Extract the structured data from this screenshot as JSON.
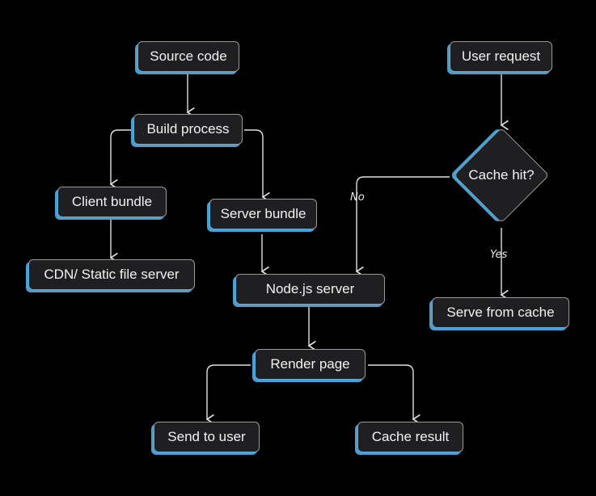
{
  "diagram": {
    "title": "",
    "nodes": [
      {
        "id": "source_code",
        "label": "Source code"
      },
      {
        "id": "build_process",
        "label": "Build process"
      },
      {
        "id": "client_bundle",
        "label": "Client bundle"
      },
      {
        "id": "server_bundle",
        "label": "Server bundle"
      },
      {
        "id": "cdn",
        "label": "CDN/ Static file server"
      },
      {
        "id": "node_server",
        "label": "Node.js server"
      },
      {
        "id": "render_page",
        "label": "Render page"
      },
      {
        "id": "send_to_user",
        "label": "Send to user"
      },
      {
        "id": "cache_result",
        "label": "Cache result"
      },
      {
        "id": "user_request",
        "label": "User request"
      },
      {
        "id": "cache_hit",
        "label": "Cache hit?"
      },
      {
        "id": "serve_from_cache",
        "label": "Serve from cache"
      }
    ],
    "edges": [
      {
        "from": "source_code",
        "to": "build_process",
        "label": ""
      },
      {
        "from": "build_process",
        "to": "client_bundle",
        "label": ""
      },
      {
        "from": "build_process",
        "to": "server_bundle",
        "label": ""
      },
      {
        "from": "client_bundle",
        "to": "cdn",
        "label": ""
      },
      {
        "from": "server_bundle",
        "to": "node_server",
        "label": ""
      },
      {
        "from": "node_server",
        "to": "render_page",
        "label": ""
      },
      {
        "from": "render_page",
        "to": "send_to_user",
        "label": ""
      },
      {
        "from": "render_page",
        "to": "cache_result",
        "label": ""
      },
      {
        "from": "user_request",
        "to": "cache_hit",
        "label": ""
      },
      {
        "from": "cache_hit",
        "to": "node_server",
        "label": "No"
      },
      {
        "from": "cache_hit",
        "to": "serve_from_cache",
        "label": "Yes"
      }
    ],
    "colors": {
      "background": "#000000",
      "node_fill": "#1f1f21",
      "node_border": "#9a9a9a",
      "accent_shadow": "#3aa3e0",
      "text": "#f2f2f2",
      "connector": "#e0e0e0"
    }
  }
}
